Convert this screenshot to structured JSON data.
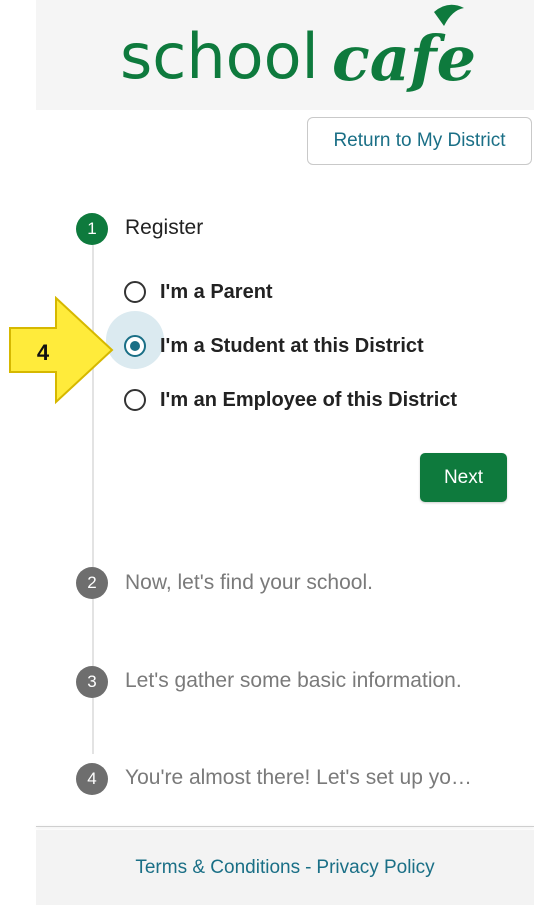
{
  "header": {
    "logo_text_light": "school",
    "logo_text_script": "cafe",
    "brand_color": "#0e7a3d"
  },
  "return_button": {
    "label": "Return to My District"
  },
  "steps": [
    {
      "number": "1",
      "label": "Register",
      "state": "active"
    },
    {
      "number": "2",
      "label": "Now, let's find your school.",
      "state": "todo"
    },
    {
      "number": "3",
      "label": "Let's gather some basic information.",
      "state": "todo"
    },
    {
      "number": "4",
      "label": "You're almost there! Let's set up yo…",
      "state": "todo"
    }
  ],
  "options": [
    {
      "label": "I'm a Parent",
      "selected": false
    },
    {
      "label": "I'm a Student at this District",
      "selected": true
    },
    {
      "label": "I'm an Employee of this District",
      "selected": false
    }
  ],
  "next_button": {
    "label": "Next"
  },
  "footer": {
    "terms": "Terms & Conditions",
    "separator": "-",
    "privacy": "Privacy Policy"
  },
  "callout": {
    "number": "4",
    "color": "#ffeb3b"
  },
  "colors": {
    "accent": "#1a6f86",
    "active_step": "#0e7a3d",
    "todo_step": "#6e6e6e"
  }
}
